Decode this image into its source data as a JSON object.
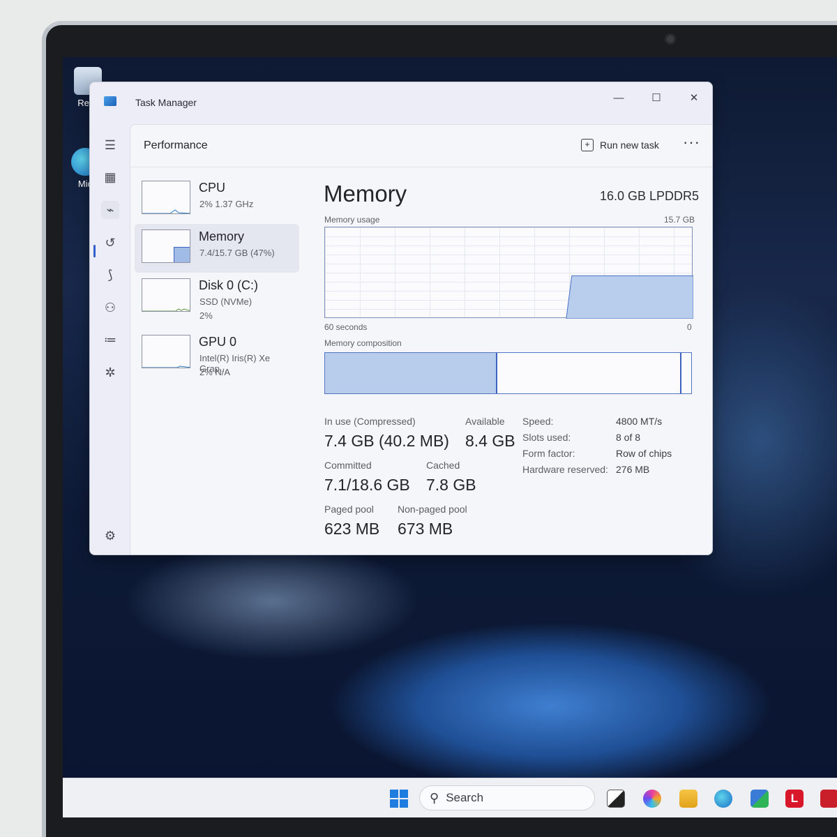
{
  "desktop": {
    "icons": [
      {
        "label": "Recy"
      },
      {
        "label": "Mic"
      }
    ]
  },
  "window": {
    "title": "Task Manager",
    "minimize": "—",
    "maximize": "☐",
    "close": "✕"
  },
  "header": {
    "title": "Performance",
    "run_task_label": "Run new task",
    "more_label": "···"
  },
  "devices": [
    {
      "name": "CPU",
      "sub": "2%  1.37 GHz",
      "sub2": ""
    },
    {
      "name": "Memory",
      "sub": "7.4/15.7 GB (47%)",
      "sub2": ""
    },
    {
      "name": "Disk 0 (C:)",
      "sub": "SSD (NVMe)",
      "sub2": "2%"
    },
    {
      "name": "GPU 0",
      "sub": "Intel(R) Iris(R) Xe Grap...",
      "sub2": "2%  N/A"
    }
  ],
  "memory": {
    "title": "Memory",
    "spec": "16.0 GB LPDDR5",
    "usage_label": "Memory usage",
    "usage_max": "15.7 GB",
    "x_left": "60 seconds",
    "x_right": "0",
    "composition_label": "Memory composition",
    "usage_fraction_recent": 0.47,
    "composition": {
      "in_use_fraction": 0.47,
      "modified_fraction": 0.02
    },
    "stats": {
      "in_use_label": "In use (Compressed)",
      "in_use_value": "7.4 GB (40.2 MB)",
      "available_label": "Available",
      "available_value": "8.4 GB",
      "committed_label": "Committed",
      "committed_value": "7.1/18.6 GB",
      "cached_label": "Cached",
      "cached_value": "7.8 GB",
      "paged_label": "Paged pool",
      "paged_value": "623 MB",
      "nonpaged_label": "Non-paged pool",
      "nonpaged_value": "673 MB"
    },
    "details": [
      {
        "key": "Speed:",
        "value": "4800 MT/s"
      },
      {
        "key": "Slots used:",
        "value": "8 of 8"
      },
      {
        "key": "Form factor:",
        "value": "Row of chips"
      },
      {
        "key": "Hardware reserved:",
        "value": "276 MB"
      }
    ]
  },
  "taskbar": {
    "search_placeholder": "Search"
  }
}
